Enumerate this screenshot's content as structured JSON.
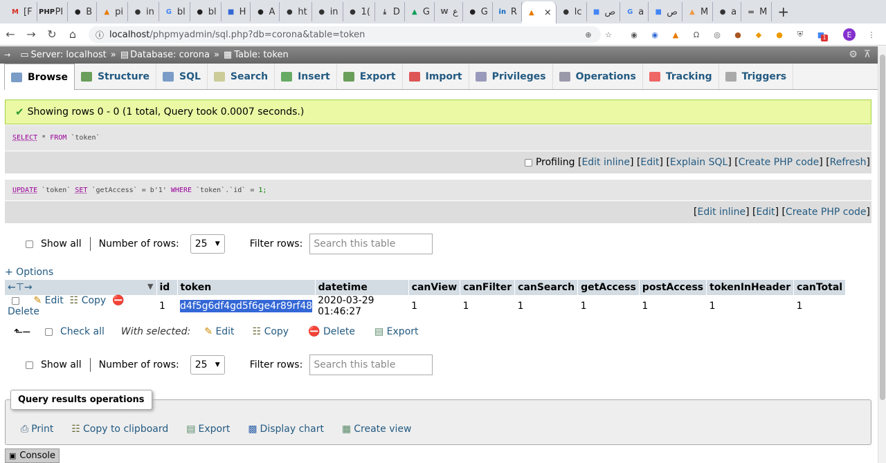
{
  "browser": {
    "tabs": [
      {
        "icon": "gmail-icon",
        "label": "[F",
        "color": "#d93025",
        "glyph": "M"
      },
      {
        "icon": "php-icon",
        "label": "PI",
        "color": "#222",
        "glyph": "PHP"
      },
      {
        "icon": "github-icon",
        "label": "B",
        "color": "#222",
        "glyph": "●"
      },
      {
        "icon": "pma-icon",
        "label": "pi",
        "color": "#e87a00",
        "glyph": "▲"
      },
      {
        "icon": "globe-icon",
        "label": "in",
        "color": "#333",
        "glyph": "●"
      },
      {
        "icon": "google-icon",
        "label": "bl",
        "color": "#4285f4",
        "glyph": "G"
      },
      {
        "icon": "github-icon",
        "label": "bl",
        "color": "#222",
        "glyph": "●"
      },
      {
        "icon": "bookmark-icon",
        "label": "H",
        "color": "#3367d6",
        "glyph": "■"
      },
      {
        "icon": "github-icon",
        "label": "A",
        "color": "#222",
        "glyph": "●"
      },
      {
        "icon": "globe-icon",
        "label": "ht",
        "color": "#333",
        "glyph": "●"
      },
      {
        "icon": "globe-icon",
        "label": "in",
        "color": "#333",
        "glyph": "●"
      },
      {
        "icon": "globe-icon",
        "label": "1(",
        "color": "#333",
        "glyph": "●"
      },
      {
        "icon": "download-icon",
        "label": "D",
        "color": "#333",
        "glyph": "⤓"
      },
      {
        "icon": "drive-icon",
        "label": "G",
        "color": "#0f9d58",
        "glyph": "▲"
      },
      {
        "icon": "wiki-icon",
        "label": "ع",
        "color": "#555",
        "glyph": "W"
      },
      {
        "icon": "github-icon",
        "label": "G",
        "color": "#222",
        "glyph": "●"
      },
      {
        "icon": "linkedin-icon",
        "label": "R",
        "color": "#0a66c2",
        "glyph": "in"
      }
    ],
    "active_tab": {
      "icon": "pma-icon",
      "color": "#e87a00",
      "glyph": "▲",
      "close": "×"
    },
    "tabs_after": [
      {
        "icon": "globe-icon",
        "label": "lc",
        "color": "#333",
        "glyph": "●"
      },
      {
        "icon": "translate-icon",
        "label": "ص",
        "color": "#4285f4",
        "glyph": "■"
      },
      {
        "icon": "google-icon",
        "label": "a",
        "color": "#4285f4",
        "glyph": "G"
      },
      {
        "icon": "translate-icon",
        "label": "ص",
        "color": "#4285f4",
        "glyph": "■"
      },
      {
        "icon": "rainbow-icon",
        "label": "M",
        "color": "#e94",
        "glyph": "▲"
      },
      {
        "icon": "globe-icon",
        "label": "a",
        "color": "#333",
        "glyph": "●"
      },
      {
        "icon": "mail-icon",
        "label": "M",
        "color": "#777",
        "glyph": "▬"
      }
    ],
    "new_tab": "+",
    "url_host": "localhost",
    "url_path": "/phpmyadmin/sql.php?db=corona&table=token",
    "profile_initial": "E",
    "ext_badge": "1"
  },
  "pma": {
    "breadcrumb": {
      "server": "Server: localhost",
      "database": "Database: corona",
      "table": "Table: token",
      "sep": "»"
    },
    "menu": [
      "Browse",
      "Structure",
      "SQL",
      "Search",
      "Insert",
      "Export",
      "Import",
      "Privileges",
      "Operations",
      "Tracking",
      "Triggers"
    ],
    "menu_colors": [
      "#7a9cc6",
      "#6a9e5b",
      "#7a9cc6",
      "#cc9",
      "#6a6",
      "#6a9e5b",
      "#d55",
      "#99b",
      "#99a",
      "#e66",
      "#aaa"
    ],
    "message": "Showing rows 0 - 0 (1 total, Query took 0.0007 seconds.)",
    "sql1": {
      "select": "SELECT",
      "star": "*",
      "from": "FROM",
      "table": "`token`"
    },
    "sql1_actions": {
      "profiling": "Profiling",
      "edit_inline": "Edit inline",
      "edit": "Edit",
      "explain": "Explain SQL",
      "php": "Create PHP code",
      "refresh": "Refresh"
    },
    "sql2": {
      "update": "UPDATE",
      "table": "`token`",
      "set": "SET",
      "col": "`getAccess`",
      "eq": "=",
      "val": "b'1'",
      "where": "WHERE",
      "cond": "`token`.`id`",
      "eq2": "=",
      "num": "1;"
    },
    "sql2_actions": {
      "edit_inline": "Edit inline",
      "edit": "Edit",
      "php": "Create PHP code"
    },
    "nav": {
      "show_all": "Show all",
      "num_rows_label": "Number of rows:",
      "num_rows": "25",
      "filter_label": "Filter rows:",
      "filter_placeholder": "Search this table"
    },
    "options": "+ Options",
    "columns": [
      "id",
      "token",
      "datetime",
      "canView",
      "canFilter",
      "canSearch",
      "getAccess",
      "postAccess",
      "tokenInHeader",
      "canTotal"
    ],
    "rows": [
      {
        "edit": "Edit",
        "copy": "Copy",
        "delete": "Delete",
        "id": "1",
        "token": "d4f5g6df4gd5f6ge4r89rf48",
        "datetime": "2020-03-29 01:46:27",
        "canView": "1",
        "canFilter": "1",
        "canSearch": "1",
        "getAccess": "1",
        "postAccess": "1",
        "tokenInHeader": "1",
        "canTotal": "1"
      }
    ],
    "bulk": {
      "check_all": "Check all",
      "with_selected": "With selected:",
      "edit": "Edit",
      "copy": "Copy",
      "delete": "Delete",
      "export": "Export"
    },
    "qro": {
      "title": "Query results operations",
      "print": "Print",
      "copy": "Copy to clipboard",
      "export": "Export",
      "chart": "Display chart",
      "view": "Create view"
    },
    "console": "Console"
  }
}
